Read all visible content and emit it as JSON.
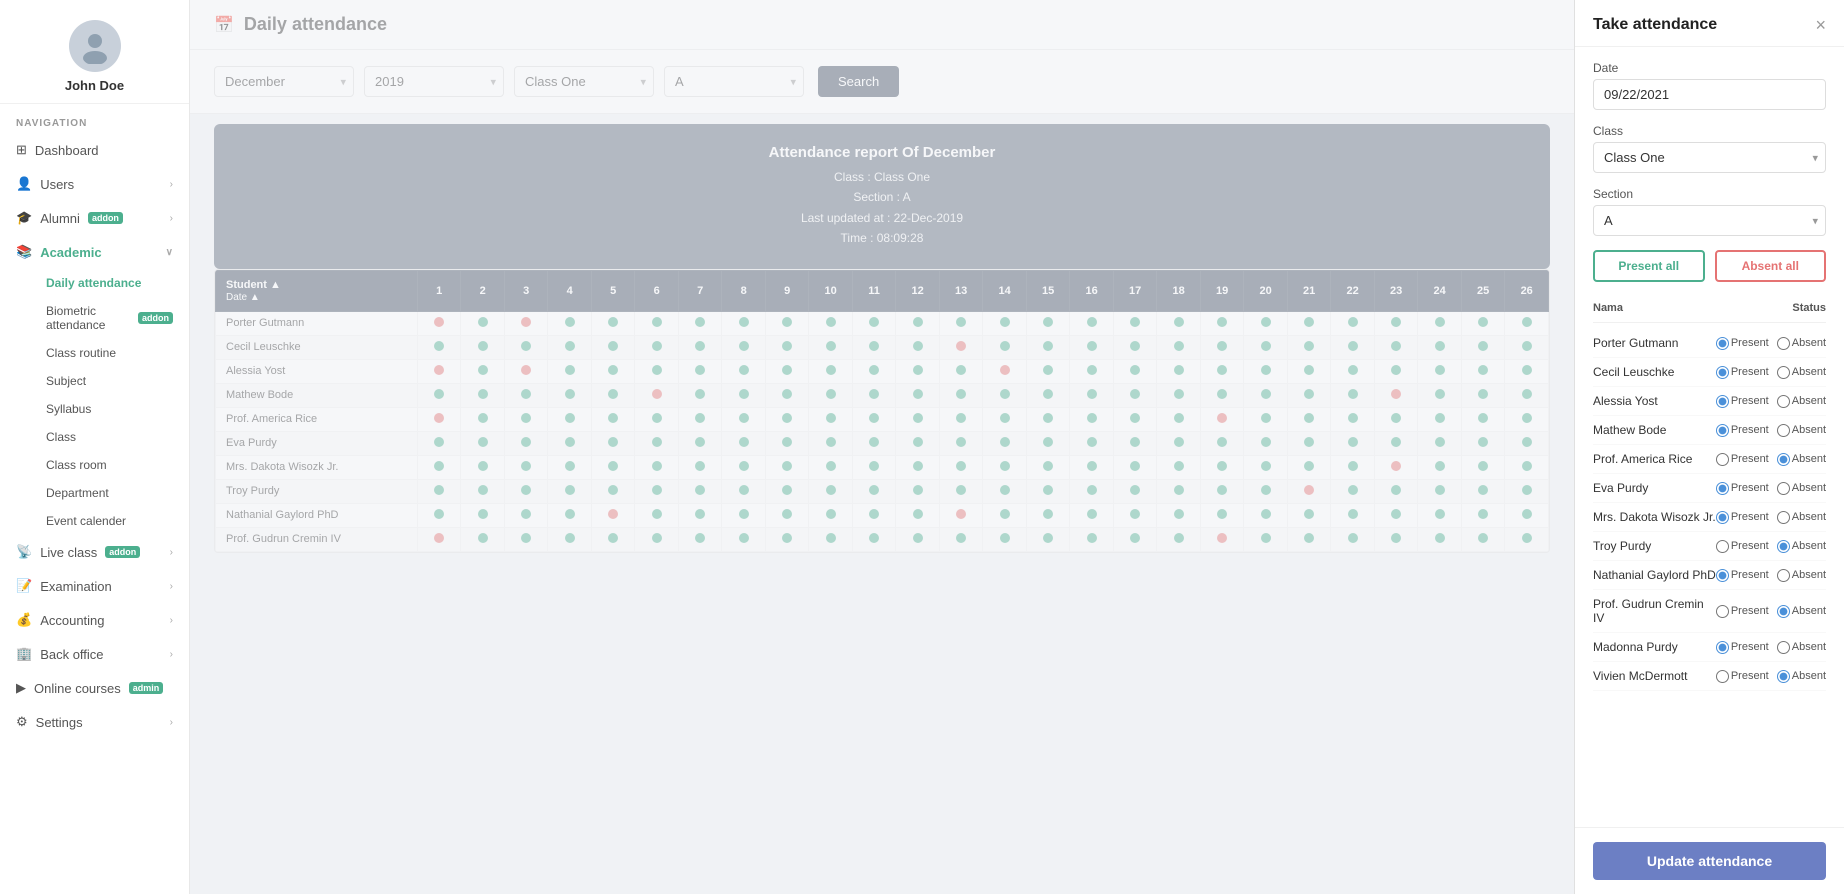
{
  "sidebar": {
    "profile": {
      "name": "John Doe"
    },
    "nav_label": "NAVIGATION",
    "items": [
      {
        "id": "dashboard",
        "label": "Dashboard",
        "icon": "dashboard",
        "hasArrow": false,
        "hasAddon": false
      },
      {
        "id": "users",
        "label": "Users",
        "icon": "users",
        "hasArrow": true,
        "hasAddon": false
      },
      {
        "id": "alumni",
        "label": "Alumni",
        "icon": "alumni",
        "hasArrow": true,
        "hasAddon": true,
        "addonLabel": "addon"
      },
      {
        "id": "academic",
        "label": "Academic",
        "icon": "academic",
        "hasArrow": true,
        "hasAddon": false,
        "expanded": true
      },
      {
        "id": "daily-attendance",
        "label": "Daily attendance",
        "icon": "",
        "hasArrow": false,
        "hasAddon": false,
        "sub": true,
        "active": true
      },
      {
        "id": "biometric-attendance",
        "label": "Biometric attendance",
        "icon": "",
        "hasArrow": false,
        "hasAddon": true,
        "addonLabel": "addon",
        "sub": true
      },
      {
        "id": "class-routine",
        "label": "Class routine",
        "icon": "",
        "hasArrow": false,
        "hasAddon": false,
        "sub": true
      },
      {
        "id": "subject",
        "label": "Subject",
        "icon": "",
        "hasArrow": false,
        "hasAddon": false,
        "sub": true
      },
      {
        "id": "syllabus",
        "label": "Syllabus",
        "icon": "",
        "hasArrow": false,
        "hasAddon": false,
        "sub": true
      },
      {
        "id": "class",
        "label": "Class",
        "icon": "",
        "hasArrow": false,
        "hasAddon": false,
        "sub": true
      },
      {
        "id": "class-room",
        "label": "Class room",
        "icon": "",
        "hasArrow": false,
        "hasAddon": false,
        "sub": true
      },
      {
        "id": "department",
        "label": "Department",
        "icon": "",
        "hasArrow": false,
        "hasAddon": false,
        "sub": true
      },
      {
        "id": "event-calender",
        "label": "Event calender",
        "icon": "",
        "hasArrow": false,
        "hasAddon": false,
        "sub": true
      },
      {
        "id": "live-class",
        "label": "Live class",
        "icon": "live",
        "hasArrow": true,
        "hasAddon": true,
        "addonLabel": "addon"
      },
      {
        "id": "examination",
        "label": "Examination",
        "icon": "exam",
        "hasArrow": true,
        "hasAddon": false
      },
      {
        "id": "accounting",
        "label": "Accounting",
        "icon": "accounting",
        "hasArrow": true,
        "hasAddon": false
      },
      {
        "id": "back-office",
        "label": "Back office",
        "icon": "office",
        "hasArrow": true,
        "hasAddon": false
      },
      {
        "id": "online-courses",
        "label": "Online courses",
        "icon": "courses",
        "hasArrow": false,
        "hasAddon": true,
        "addonLabel": "admin"
      },
      {
        "id": "settings",
        "label": "Settings",
        "icon": "settings",
        "hasArrow": true,
        "hasAddon": false
      }
    ]
  },
  "header": {
    "icon": "📅",
    "title": "Daily attendance"
  },
  "filters": {
    "month": "December",
    "year": "2019",
    "class": "Class One",
    "section": "A",
    "search_label": "Search"
  },
  "report": {
    "title": "Attendance report Of December",
    "class_label": "Class : Class One",
    "section_label": "Section : A",
    "updated_label": "Last updated at : 22-Dec-2019",
    "time_label": "Time : 08:09:28"
  },
  "table": {
    "student_col": "Student ▲",
    "date_col": "Date ▲",
    "days": [
      "1",
      "2",
      "3",
      "4",
      "5",
      "6",
      "7",
      "8",
      "9",
      "10",
      "11",
      "12",
      "13",
      "14",
      "15",
      "16",
      "17",
      "18",
      "19",
      "20",
      "21",
      "22",
      "23",
      "24",
      "25",
      "26"
    ],
    "students": [
      {
        "name": "Porter Gutmann",
        "attendance": [
          "absent",
          "present",
          "absent",
          "present",
          "present",
          "present",
          "present",
          "present",
          "present",
          "present",
          "present",
          "present",
          "present",
          "present",
          "present",
          "present",
          "present",
          "present",
          "present",
          "present",
          "present",
          "present",
          "present",
          "present",
          "present",
          "present"
        ]
      },
      {
        "name": "Cecil Leuschke",
        "attendance": [
          "present",
          "present",
          "present",
          "present",
          "present",
          "present",
          "present",
          "present",
          "present",
          "present",
          "present",
          "present",
          "absent",
          "present",
          "present",
          "present",
          "present",
          "present",
          "present",
          "present",
          "present",
          "present",
          "present",
          "present",
          "present",
          "present"
        ]
      },
      {
        "name": "Alessia Yost",
        "attendance": [
          "absent",
          "present",
          "absent",
          "present",
          "present",
          "present",
          "present",
          "present",
          "present",
          "present",
          "present",
          "present",
          "present",
          "absent",
          "present",
          "present",
          "present",
          "present",
          "present",
          "present",
          "present",
          "present",
          "present",
          "present",
          "present",
          "present"
        ]
      },
      {
        "name": "Mathew Bode",
        "attendance": [
          "present",
          "present",
          "present",
          "present",
          "present",
          "absent",
          "present",
          "present",
          "present",
          "present",
          "present",
          "present",
          "present",
          "present",
          "present",
          "present",
          "present",
          "present",
          "present",
          "present",
          "present",
          "present",
          "absent",
          "present",
          "present",
          "present"
        ]
      },
      {
        "name": "Prof. America Rice",
        "attendance": [
          "absent",
          "present",
          "present",
          "present",
          "present",
          "present",
          "present",
          "present",
          "present",
          "present",
          "present",
          "present",
          "present",
          "present",
          "present",
          "present",
          "present",
          "present",
          "absent",
          "present",
          "present",
          "present",
          "present",
          "present",
          "present",
          "present"
        ]
      },
      {
        "name": "Eva Purdy",
        "attendance": [
          "present",
          "present",
          "present",
          "present",
          "present",
          "present",
          "present",
          "present",
          "present",
          "present",
          "present",
          "present",
          "present",
          "present",
          "present",
          "present",
          "present",
          "present",
          "present",
          "present",
          "present",
          "present",
          "present",
          "present",
          "present",
          "present"
        ]
      },
      {
        "name": "Mrs. Dakota Wisozk Jr.",
        "attendance": [
          "present",
          "present",
          "present",
          "present",
          "present",
          "present",
          "present",
          "present",
          "present",
          "present",
          "present",
          "present",
          "present",
          "present",
          "present",
          "present",
          "present",
          "present",
          "present",
          "present",
          "present",
          "present",
          "absent",
          "present",
          "present",
          "present"
        ]
      },
      {
        "name": "Troy Purdy",
        "attendance": [
          "present",
          "present",
          "present",
          "present",
          "present",
          "present",
          "present",
          "present",
          "present",
          "present",
          "present",
          "present",
          "present",
          "present",
          "present",
          "present",
          "present",
          "present",
          "present",
          "present",
          "absent",
          "present",
          "present",
          "present",
          "present",
          "present"
        ]
      },
      {
        "name": "Nathanial Gaylord PhD",
        "attendance": [
          "present",
          "present",
          "present",
          "present",
          "absent",
          "present",
          "present",
          "present",
          "present",
          "present",
          "present",
          "present",
          "absent",
          "present",
          "present",
          "present",
          "present",
          "present",
          "present",
          "present",
          "present",
          "present",
          "present",
          "present",
          "present",
          "present"
        ]
      },
      {
        "name": "Prof. Gudrun Cremin IV",
        "attendance": [
          "absent",
          "present",
          "present",
          "present",
          "present",
          "present",
          "present",
          "present",
          "present",
          "present",
          "present",
          "present",
          "present",
          "present",
          "present",
          "present",
          "present",
          "present",
          "absent",
          "present",
          "present",
          "present",
          "present",
          "present",
          "present",
          "present"
        ]
      }
    ]
  },
  "panel": {
    "title": "Take attendance",
    "close_label": "×",
    "date_label": "Date",
    "date_value": "09/22/2021",
    "class_label": "Class",
    "class_value": "Class One",
    "section_label": "Section",
    "section_value": "A",
    "present_all_label": "Present all",
    "absent_all_label": "Absent all",
    "col_name": "Nama",
    "col_status": "Status",
    "students": [
      {
        "name": "Porter Gutmann",
        "status": "present"
      },
      {
        "name": "Cecil Leuschke",
        "status": "present"
      },
      {
        "name": "Alessia Yost",
        "status": "present"
      },
      {
        "name": "Mathew Bode",
        "status": "present"
      },
      {
        "name": "Prof. America Rice",
        "status": "absent"
      },
      {
        "name": "Eva Purdy",
        "status": "present"
      },
      {
        "name": "Mrs. Dakota Wisozk Jr.",
        "status": "present"
      },
      {
        "name": "Troy Purdy",
        "status": "absent"
      },
      {
        "name": "Nathanial Gaylord PhD",
        "status": "present"
      },
      {
        "name": "Prof. Gudrun Cremin IV",
        "status": "absent"
      },
      {
        "name": "Madonna Purdy",
        "status": "present"
      },
      {
        "name": "Vivien McDermott",
        "status": "absent"
      }
    ],
    "update_label": "Update attendance"
  }
}
